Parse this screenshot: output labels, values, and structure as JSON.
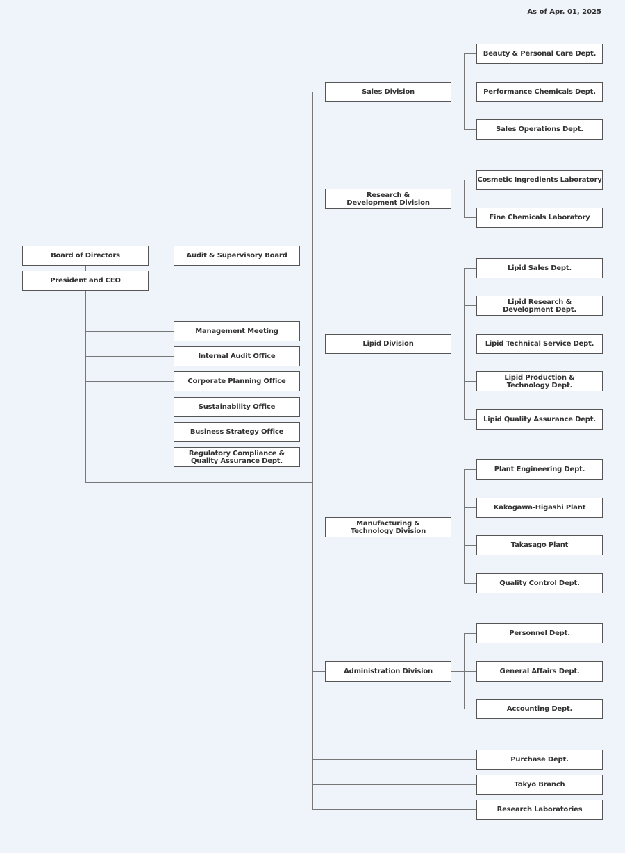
{
  "as_of": "As of Apr. 01, 2025",
  "top": {
    "board": "Board of Directors",
    "audit_board": "Audit & Supervisory Board",
    "ceo": "President and CEO"
  },
  "staff_offices": [
    "Management Meeting",
    "Internal Audit Office",
    "Corporate Planning Office",
    "Sustainability Office",
    "Business Strategy Office",
    "Regulatory Compliance & Quality Assurance Dept."
  ],
  "divisions": [
    {
      "name": "Sales Division",
      "depts": [
        "Beauty & Personal Care Dept.",
        "Performance Chemicals Dept.",
        "Sales Operations Dept."
      ]
    },
    {
      "name": "Research & Development Division",
      "depts": [
        "Cosmetic Ingredients Laboratory",
        "Fine Chemicals Laboratory"
      ]
    },
    {
      "name": "Lipid Division",
      "depts": [
        "Lipid Sales Dept.",
        "Lipid Research & Development Dept.",
        "Lipid Technical Service Dept.",
        "Lipid Production & Technology Dept.",
        "Lipid Quality Assurance Dept."
      ]
    },
    {
      "name": "Manufacturing & Technology Division",
      "depts": [
        "Plant Engineering Dept.",
        "Kakogawa-Higashi Plant",
        "Takasago Plant",
        "Quality Control Dept."
      ]
    },
    {
      "name": "Administration Division",
      "depts": [
        "Personnel Dept.",
        "General Affairs Dept.",
        "Accounting Dept."
      ]
    }
  ],
  "direct_units": [
    "Purchase Dept.",
    "Tokyo Branch",
    "Research Laboratories"
  ]
}
